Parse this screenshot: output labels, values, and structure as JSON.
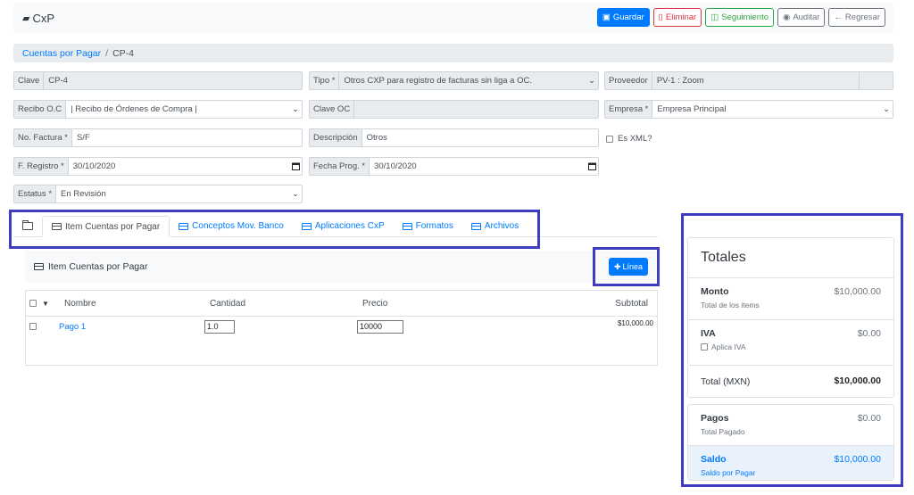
{
  "header": {
    "title": "CxP",
    "buttons": {
      "guardar": "Guardar",
      "eliminar": "Eliminar",
      "seguimiento": "Seguimiento",
      "auditar": "Auditar",
      "regresar": "Regresar"
    }
  },
  "breadcrumb": {
    "parent": "Cuentas por Pagar",
    "separator": "/",
    "current": "CP-4"
  },
  "form": {
    "clave": {
      "label": "Clave",
      "value": "CP-4"
    },
    "tipo": {
      "label": "Tipo *",
      "value": "Otros CXP para registro de facturas sin liga a OC."
    },
    "proveedor": {
      "label": "Proveedor",
      "value": "PV-1 : Zoom"
    },
    "recibo": {
      "label": "Recibo O.C",
      "value": "| Recibo de Órdenes de Compra |"
    },
    "clave_oc": {
      "label": "Clave OC",
      "value": ""
    },
    "empresa": {
      "label": "Empresa *",
      "value": "Empresa Principal"
    },
    "factura": {
      "label": "No. Factura *",
      "value": "S/F"
    },
    "descripcion": {
      "label": "Descripción",
      "value": "Otros"
    },
    "es_xml": {
      "label": "Es XML?",
      "checked": false
    },
    "f_registro": {
      "label": "F. Registro *",
      "value": "30/10/2020"
    },
    "fecha_prog": {
      "label": "Fecha Prog. *",
      "value": "30/10/2020"
    },
    "estatus": {
      "label": "Estatus *",
      "value": "En Revisión"
    }
  },
  "tabs": [
    {
      "label": "Item Cuentas por Pagar",
      "active": true
    },
    {
      "label": "Conceptos Mov. Banco"
    },
    {
      "label": "Aplicaciones CxP"
    },
    {
      "label": "Formatos"
    },
    {
      "label": "Archivos"
    }
  ],
  "items": {
    "title": "Item Cuentas por Pagar",
    "add_button": "Línea",
    "columns": {
      "nombre": "Nombre",
      "cantidad": "Cantidad",
      "precio": "Precio",
      "subtotal": "Subtotal"
    },
    "rows": [
      {
        "nombre": "Pago 1",
        "cantidad": "1.0",
        "precio": "10000",
        "subtotal": "$10,000.00"
      }
    ]
  },
  "totales": {
    "title": "Totales",
    "monto": {
      "label": "Monto",
      "sub": "Total de los items",
      "value": "$10,000.00"
    },
    "iva": {
      "label": "IVA",
      "sub": "Aplica IVA",
      "value": "$0.00"
    },
    "total": {
      "label": "Total (MXN)",
      "value": "$10,000.00"
    },
    "pagos": {
      "label": "Pagos",
      "sub": "Total Pagado",
      "value": "$0.00"
    },
    "saldo": {
      "label": "Saldo",
      "sub": "Saldo por Pagar",
      "value": "$10,000.00"
    }
  },
  "colors": {
    "primary": "#007bff",
    "danger": "#dc3545",
    "success": "#28a745",
    "highlight": "#3d3dbd"
  }
}
